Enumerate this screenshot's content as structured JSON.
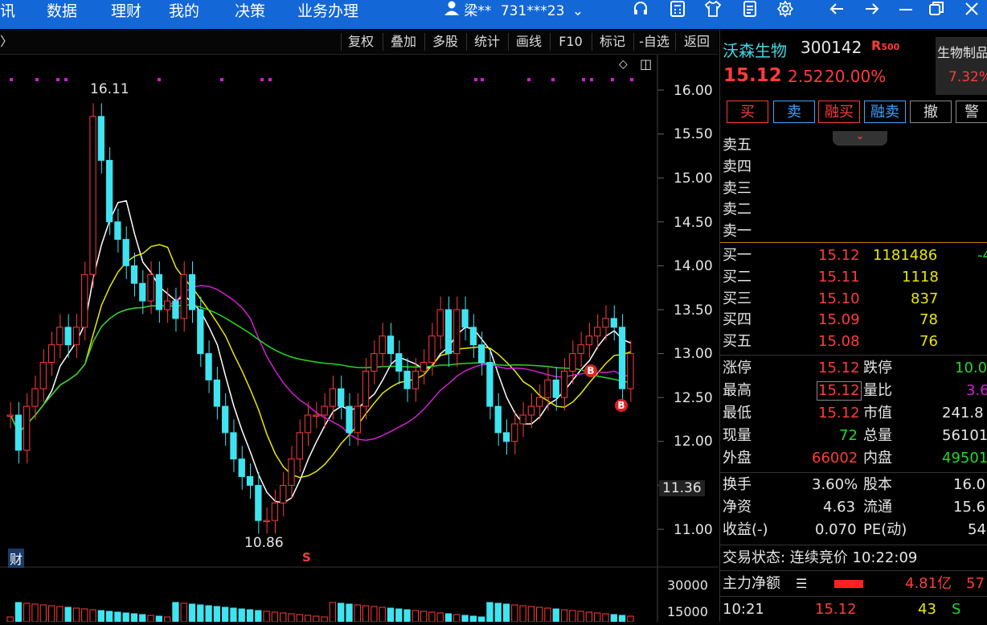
{
  "menu": {
    "items": [
      "讯",
      "数据",
      "理财",
      "我的",
      "决策",
      "业务办理"
    ]
  },
  "user": {
    "name": "梁**",
    "account": "731***23"
  },
  "window_icons": [
    "headset-icon",
    "calculator-icon",
    "shirt-icon",
    "note-icon",
    "gear-icon",
    "back-icon",
    "forward-icon",
    "minimize-icon",
    "restore-icon",
    "close-icon"
  ],
  "toolbar": {
    "back_glyph": "〉",
    "buttons": [
      "复权",
      "叠加",
      "多股",
      "统计",
      "画线",
      "F10",
      "标记",
      "-自选",
      "返回"
    ]
  },
  "chart": {
    "price_axis": [
      "16.00",
      "15.50",
      "15.00",
      "14.50",
      "14.00",
      "13.50",
      "13.00",
      "12.50",
      "12.00",
      "11.50",
      "11.00"
    ],
    "current_price_tag": "11.36",
    "high_label": "16.11",
    "low_label": "10.86",
    "cai_label": "财",
    "s_label": "S",
    "b_label": "B",
    "volume_axis": [
      "30000",
      "15000"
    ],
    "colors": {
      "up": "#ff3b3b",
      "down": "#3fe4f0",
      "ma5": "#ffffff",
      "ma10": "#e8e800",
      "ma20": "#d21ed2",
      "ma60": "#27d727"
    }
  },
  "quote": {
    "name": "沃森生物",
    "code": "300142",
    "badge": "R",
    "badge_num": "500",
    "sector": "生物制品",
    "sector_change": "7.32%",
    "price": "15.12",
    "change": "2.52",
    "change_pct": "20.00%",
    "trade_buttons": [
      "买",
      "卖",
      "融买",
      "融卖",
      "撤",
      "警"
    ],
    "sell_rows": [
      {
        "label": "卖五"
      },
      {
        "label": "卖四"
      },
      {
        "label": "卖三"
      },
      {
        "label": "卖二"
      },
      {
        "label": "卖一"
      }
    ],
    "buy_rows": [
      {
        "label": "买一",
        "price": "15.12",
        "vol": "1181486",
        "extra": "-4"
      },
      {
        "label": "买二",
        "price": "15.11",
        "vol": "1118",
        "extra": ""
      },
      {
        "label": "买三",
        "price": "15.10",
        "vol": "837",
        "extra": ""
      },
      {
        "label": "买四",
        "price": "15.09",
        "vol": "78",
        "extra": ""
      },
      {
        "label": "买五",
        "price": "15.08",
        "vol": "76",
        "extra": ""
      }
    ],
    "stats": [
      {
        "l1": "涨停",
        "v1": "15.12",
        "l2": "跌停",
        "v2": "10.0"
      },
      {
        "l1": "最高",
        "v1": "15.12",
        "l2": "量比",
        "v2": "3.6"
      },
      {
        "l1": "最低",
        "v1": "15.12",
        "l2": "市值",
        "v2": "241.8"
      },
      {
        "l1": "现量",
        "v1": "72",
        "l2": "总量",
        "v2": "56101"
      },
      {
        "l1": "外盘",
        "v1": "66002",
        "l2": "内盘",
        "v2": "49501"
      }
    ],
    "stats2": [
      {
        "l1": "换手",
        "v1": "3.60%",
        "l2": "股本",
        "v2": "16.0"
      },
      {
        "l1": "净资",
        "v1": "4.63",
        "l2": "流通",
        "v2": "15.6"
      },
      {
        "l1": "收益(-)",
        "v1": "0.070",
        "l2": "PE(动)",
        "v2": "54"
      }
    ],
    "trade_status": "交易状态: 连续竞价 10:22:09",
    "main_flow_label": "主力净额",
    "main_flow_value": "4.81亿",
    "main_flow_extra": "57",
    "tick": {
      "time": "10:21",
      "price": "15.12",
      "vol": "43",
      "side": "S"
    }
  }
}
